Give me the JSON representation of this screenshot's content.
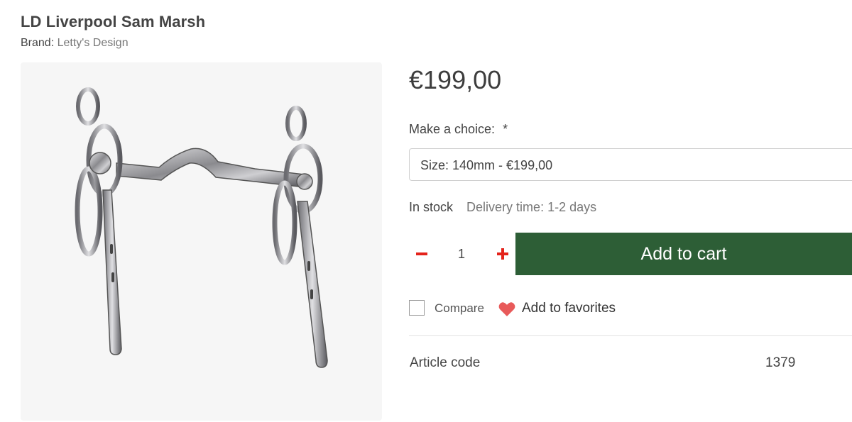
{
  "product": {
    "title": "LD Liverpool Sam Marsh",
    "brand_label": "Brand:",
    "brand_name": "Letty's Design",
    "price": "€199,00"
  },
  "options": {
    "choice_label": "Make a choice:",
    "required_mark": "*",
    "selected_value": "Size: 140mm - €199,00"
  },
  "availability": {
    "stock": "In stock",
    "delivery": "Delivery time: 1-2 days"
  },
  "cart": {
    "quantity": "1",
    "add_to_cart_label": "Add to cart",
    "button_color": "#2d5e36",
    "stepper_color": "#e4231b"
  },
  "actions": {
    "compare_label": "Compare",
    "favorites_label": "Add to favorites",
    "heart_color": "#e85a5a"
  },
  "specs": [
    {
      "label": "Article code",
      "value": "1379"
    }
  ],
  "icons": [
    "minus-icon",
    "plus-icon",
    "heart-icon",
    "checkbox"
  ]
}
